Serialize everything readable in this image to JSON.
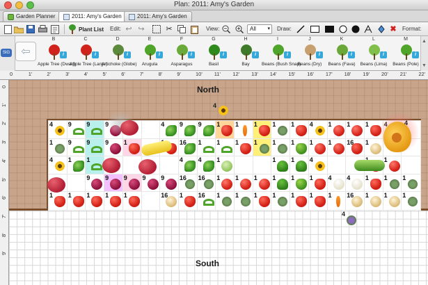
{
  "window": {
    "title": "Plan: 2011: Amy's Garden"
  },
  "tabs": [
    {
      "label": "Garden Planner",
      "active": false
    },
    {
      "label": "2011: Amy's Garden",
      "active": true
    },
    {
      "label": "2011: Amy's Garden",
      "active": false
    }
  ],
  "toolbar": {
    "plant_list_label": "Plant List",
    "edit_label": "Edit:",
    "view_label": "View:",
    "zoom_value": "All",
    "draw_label": "Draw:",
    "format_label": "Format:"
  },
  "palette": {
    "badge": "SIG",
    "items": [
      {
        "letter": "B",
        "name": "Apple Tree (Dwarf)",
        "icon": "apple-tree-icon"
      },
      {
        "letter": "C",
        "name": "Apple Tree (Large)",
        "icon": "apple-tree-icon"
      },
      {
        "letter": "D",
        "name": "Artichoke (Globe)",
        "icon": "artichoke-icon"
      },
      {
        "letter": "E",
        "name": "Arugula",
        "icon": "arugula-icon"
      },
      {
        "letter": "F",
        "name": "Asparagus",
        "icon": "asparagus-icon"
      },
      {
        "letter": "G",
        "name": "Basil",
        "icon": "basil-icon"
      },
      {
        "letter": "H",
        "name": "Bay",
        "icon": "bay-icon"
      },
      {
        "letter": "I",
        "name": "Beans (Bush Snap)",
        "icon": "beans-icon"
      },
      {
        "letter": "J",
        "name": "Beans (Dry)",
        "icon": "beans-icon"
      },
      {
        "letter": "K",
        "name": "Beans (Fava)",
        "icon": "beans-icon"
      },
      {
        "letter": "L",
        "name": "Beans (Lima)",
        "icon": "beans-icon"
      },
      {
        "letter": "M",
        "name": "Beans (Pole)",
        "icon": "beans-icon"
      }
    ]
  },
  "ruler": {
    "top": [
      "0",
      "1'",
      "2'",
      "3'",
      "4'",
      "5'",
      "6'",
      "7'",
      "8'",
      "9'",
      "10'",
      "11'",
      "12'",
      "13'",
      "14'",
      "15'",
      "16'",
      "17'",
      "18'",
      "19'",
      "20'",
      "21'",
      "22'"
    ],
    "left": [
      "0",
      "1'",
      "2'",
      "3'",
      "4'",
      "5'",
      "6'",
      "7'",
      "8'",
      "9'"
    ]
  },
  "canvas": {
    "north_label": "North",
    "south_label": "South",
    "north_flower_count": "4",
    "south_herb_count": "4",
    "colors": {
      "dirt": "#c7a48a",
      "bed_border": "#7a4d2b",
      "grid": "#d6d6d6"
    }
  },
  "bed": {
    "rows": [
      [
        {
          "n": "4",
          "v": "flower",
          "bg": "#ffffff"
        },
        {
          "n": "9",
          "v": "pea",
          "bg": "#ffffff"
        },
        {
          "n": "9",
          "v": "pea",
          "bg": "#b8f0ee"
        },
        {
          "n": "9",
          "v": "beet",
          "bg": "#ffffff"
        },
        {
          "n": "",
          "v": "",
          "bg": "#ffffff"
        },
        {
          "n": "",
          "v": "",
          "bg": "#ffffff"
        },
        {
          "n": "4",
          "v": "leaf",
          "bg": "#ffffff"
        },
        {
          "n": "9",
          "v": "leaf",
          "bg": "#ffffff"
        },
        {
          "n": "9",
          "v": "leaf",
          "bg": "#ffffff"
        },
        {
          "n": "1",
          "v": "pep",
          "bg": "#ffd59a"
        },
        {
          "n": "1",
          "v": "carrot",
          "bg": "#ffffff"
        },
        {
          "n": "1",
          "v": "pep",
          "bg": "#fff07a"
        },
        {
          "n": "1",
          "v": "herb",
          "bg": "#ffffff"
        },
        {
          "n": "1",
          "v": "pep",
          "bg": "#ffffff"
        },
        {
          "n": "4",
          "v": "flower",
          "bg": "#ffffff"
        },
        {
          "n": "1",
          "v": "tom",
          "bg": "#ffffff"
        },
        {
          "n": "1",
          "v": "tom",
          "bg": "#ffffff"
        },
        {
          "n": "1",
          "v": "pep",
          "bg": "#ffffff"
        },
        {
          "n": "4",
          "v": "flower",
          "bg": "#ffffff"
        },
        {
          "n": "",
          "v": "",
          "bg": "#ffffff"
        }
      ],
      [
        {
          "n": "1",
          "v": "herb",
          "bg": "#ffffff"
        },
        {
          "n": "9",
          "v": "pea",
          "bg": "#ffffff"
        },
        {
          "n": "9",
          "v": "pea",
          "bg": "#b8f0ee"
        },
        {
          "n": "9",
          "v": "beet",
          "bg": "#ffffff"
        },
        {
          "n": "1",
          "v": "pep",
          "bg": "#ffd6e6"
        },
        {
          "n": "",
          "v": "",
          "bg": "#ffffff"
        },
        {
          "n": "1",
          "v": "pep",
          "bg": "#ffffff"
        },
        {
          "n": "16",
          "v": "leaf",
          "bg": "#ffffff"
        },
        {
          "n": "1",
          "v": "pea",
          "bg": "#ffffff"
        },
        {
          "n": "1",
          "v": "pea",
          "bg": "#ffffff"
        },
        {
          "n": "1",
          "v": "pep",
          "bg": "#ffffff"
        },
        {
          "n": "1",
          "v": "herb",
          "bg": "#fff07a"
        },
        {
          "n": "1",
          "v": "herb",
          "bg": "#ffffff"
        },
        {
          "n": "1",
          "v": "pepg",
          "bg": "#ffffff"
        },
        {
          "n": "1",
          "v": "tom",
          "bg": "#ffffff"
        },
        {
          "n": "1",
          "v": "tom",
          "bg": "#ffffff"
        },
        {
          "n": "16",
          "v": "pep",
          "bg": "#ffffff"
        },
        {
          "n": "1",
          "v": "onion",
          "bg": "#ffffff"
        },
        {
          "n": "",
          "v": "",
          "bg": "#ffffff"
        },
        {
          "n": "",
          "v": "",
          "bg": "#ffffff"
        }
      ],
      [
        {
          "n": "4",
          "v": "flower",
          "bg": "#ffffff"
        },
        {
          "n": "1",
          "v": "leaf",
          "bg": "#ffffff"
        },
        {
          "n": "1",
          "v": "pea",
          "bg": "#b8f0ee"
        },
        {
          "n": "",
          "v": "",
          "bg": "#ffffff"
        },
        {
          "n": "",
          "v": "",
          "bg": "#ffffff"
        },
        {
          "n": "",
          "v": "",
          "bg": "#ffffff"
        },
        {
          "n": "",
          "v": "",
          "bg": "#ffffff"
        },
        {
          "n": "4",
          "v": "leaf",
          "bg": "#ffffff"
        },
        {
          "n": "4",
          "v": "leaf",
          "bg": "#ffffff"
        },
        {
          "n": "1",
          "v": "cab",
          "bg": "#ffffff"
        },
        {
          "n": "",
          "v": "",
          "bg": "#ffffff"
        },
        {
          "n": "",
          "v": "",
          "bg": "#ffffff"
        },
        {
          "n": "1",
          "v": "brocc",
          "bg": "#ffffff"
        },
        {
          "n": "1",
          "v": "brocc",
          "bg": "#ffffff"
        },
        {
          "n": "4",
          "v": "flower",
          "bg": "#ffffff"
        },
        {
          "n": "",
          "v": "",
          "bg": "#ffffff"
        },
        {
          "n": "",
          "v": "",
          "bg": "#ffffff"
        },
        {
          "n": "1",
          "v": "pep",
          "bg": "#ffffff"
        },
        {
          "n": "1",
          "v": "tom",
          "bg": "#ffffff"
        },
        {
          "n": "",
          "v": "",
          "bg": "#ffffff"
        }
      ],
      [
        {
          "n": "",
          "v": "",
          "bg": "#ffffff"
        },
        {
          "n": "",
          "v": "",
          "bg": "#ffffff"
        },
        {
          "n": "9",
          "v": "beet",
          "bg": "#ffffff"
        },
        {
          "n": "9",
          "v": "beet",
          "bg": "#f3c0ff"
        },
        {
          "n": "9",
          "v": "beet",
          "bg": "#ffd6e6"
        },
        {
          "n": "9",
          "v": "beet",
          "bg": "#ffffff"
        },
        {
          "n": "9",
          "v": "beet",
          "bg": "#ffffff"
        },
        {
          "n": "16",
          "v": "herb",
          "bg": "#ffffff"
        },
        {
          "n": "16",
          "v": "herb",
          "bg": "#ffffff"
        },
        {
          "n": "1",
          "v": "tom",
          "bg": "#ffffff"
        },
        {
          "n": "1",
          "v": "tom",
          "bg": "#ffffff"
        },
        {
          "n": "1",
          "v": "tom",
          "bg": "#ffffff"
        },
        {
          "n": "1",
          "v": "brocc",
          "bg": "#ffffff"
        },
        {
          "n": "1",
          "v": "pepg",
          "bg": "#ffffff"
        },
        {
          "n": "1",
          "v": "pep",
          "bg": "#ffffff"
        },
        {
          "n": "4",
          "v": "cauli",
          "bg": "#ffffff"
        },
        {
          "n": "4",
          "v": "cauli",
          "bg": "#ffffff"
        },
        {
          "n": "1",
          "v": "pep",
          "bg": "#ffffff"
        },
        {
          "n": "1",
          "v": "herb",
          "bg": "#ffffff"
        },
        {
          "n": "1",
          "v": "herb",
          "bg": "#ffffff"
        }
      ],
      [
        {
          "n": "1",
          "v": "pep",
          "bg": "#ffffff"
        },
        {
          "n": "1",
          "v": "pep",
          "bg": "#ffffff"
        },
        {
          "n": "1",
          "v": "pep",
          "bg": "#ffffff"
        },
        {
          "n": "1",
          "v": "pep",
          "bg": "#ffffff"
        },
        {
          "n": "1",
          "v": "pep",
          "bg": "#ffffff"
        },
        {
          "n": "",
          "v": "",
          "bg": "#ffffff"
        },
        {
          "n": "16",
          "v": "onion",
          "bg": "#ffffff"
        },
        {
          "n": "1",
          "v": "pep",
          "bg": "#ffffff"
        },
        {
          "n": "16",
          "v": "pea",
          "bg": "#ffffff"
        },
        {
          "n": "1",
          "v": "herb",
          "bg": "#ffffff"
        },
        {
          "n": "1",
          "v": "herb",
          "bg": "#ffffff"
        },
        {
          "n": "1",
          "v": "pep",
          "bg": "#ffffff"
        },
        {
          "n": "1",
          "v": "herb",
          "bg": "#ffffff"
        },
        {
          "n": "1",
          "v": "pep",
          "bg": "#ffffff"
        },
        {
          "n": "1",
          "v": "pep",
          "bg": "#ffffff"
        },
        {
          "n": "1",
          "v": "carrot",
          "bg": "#ffffff"
        },
        {
          "n": "16",
          "v": "onion",
          "bg": "#ffffff"
        },
        {
          "n": "1",
          "v": "onion",
          "bg": "#ffffff"
        },
        {
          "n": "1",
          "v": "onion",
          "bg": "#ffffff"
        },
        {
          "n": "1",
          "v": "herb",
          "bg": "#ffffff"
        }
      ]
    ]
  }
}
